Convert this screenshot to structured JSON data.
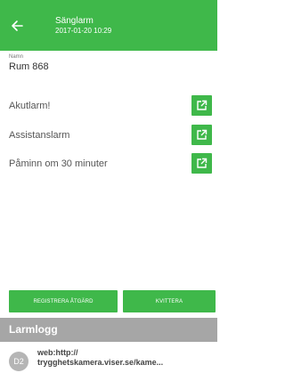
{
  "header": {
    "title": "Sänglarm",
    "timestamp": "2017-01-20 10:29",
    "back_icon": "arrow-left-icon",
    "color": "#3fb84a"
  },
  "name": {
    "label": "Namn",
    "value": "Rum 868"
  },
  "alarms": [
    {
      "label": "Akutlarm!",
      "icon": "open-external-icon"
    },
    {
      "label": "Assistanslarm",
      "icon": "open-external-icon"
    },
    {
      "label": "Påminn om 30 minuter",
      "icon": "open-external-icon"
    }
  ],
  "actions": {
    "register_label": "REGISTRERA ÅTGÄRD",
    "acknowledge_label": "KVITTERA"
  },
  "log": {
    "title": "Larmlogg",
    "entries": [
      {
        "avatar": "D2",
        "line1": "web:http://",
        "line2": "trygghetskamera.viser.se/kame..."
      }
    ]
  }
}
